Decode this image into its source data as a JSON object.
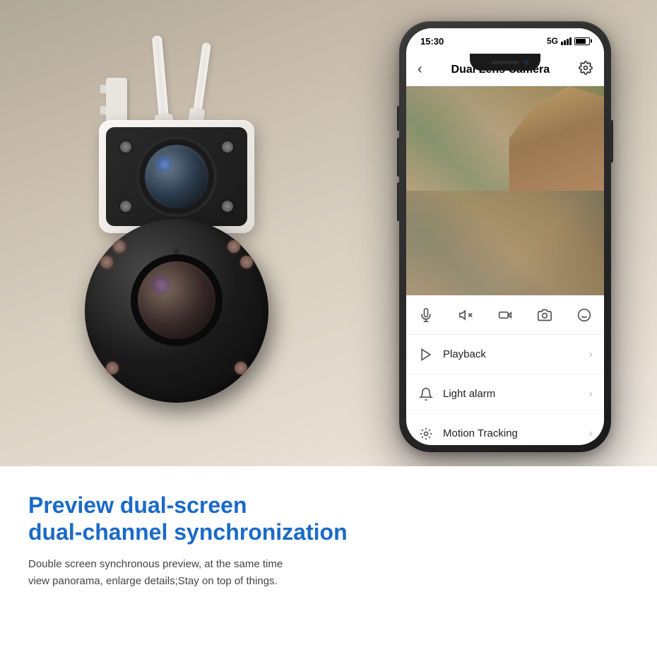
{
  "statusBar": {
    "time": "15:30",
    "signal": "5G",
    "batteryLevel": "75"
  },
  "appHeader": {
    "title": "Dual Lens Camera",
    "backIcon": "‹",
    "gearIcon": "⚙"
  },
  "controlBar": {
    "micIcon": "mic",
    "muteIcon": "mute",
    "recordIcon": "record",
    "snapIcon": "snapshot",
    "faceIcon": "face-detect"
  },
  "menuItems": [
    {
      "id": "playback",
      "label": "Playback",
      "icon": "play"
    },
    {
      "id": "light-alarm",
      "label": "Light alarm",
      "icon": "light"
    },
    {
      "id": "motion-tracking",
      "label": "Motion Tracking",
      "icon": "motion"
    }
  ],
  "bottomText": {
    "title": "Preview dual-screen\ndual-channel synchronization",
    "description": "Double screen synchronous preview, at the same time view panorama, enlarge details;Stay on top of things."
  }
}
